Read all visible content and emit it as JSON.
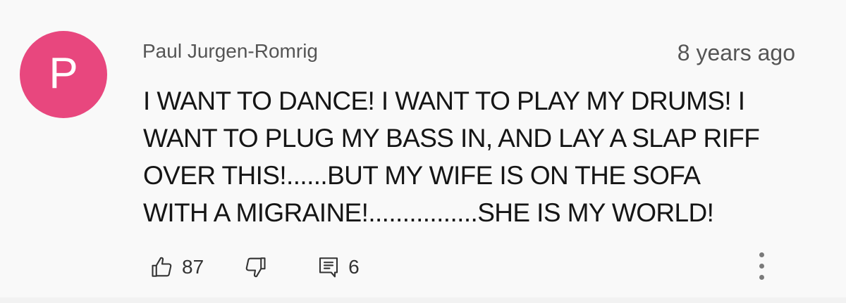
{
  "comment": {
    "avatar_letter": "P",
    "avatar_color": "#e8477e",
    "author": "Paul Jurgen-Romrig",
    "timestamp": "8 years ago",
    "text_lines": [
      "I WANT TO DANCE! I WANT TO PLAY MY DRUMS! I",
      "WANT TO PLUG MY BASS IN, AND LAY A SLAP RIFF",
      "OVER THIS!......BUT MY WIFE IS ON THE SOFA",
      "WITH A MIGRAINE!................SHE IS MY WORLD!"
    ],
    "actions": {
      "like_icon": "thumbs-up-icon",
      "like_count": "87",
      "dislike_icon": "thumbs-down-icon",
      "reply_icon": "reply-comment-icon",
      "reply_count": "6",
      "more_icon": "more-vertical-icon"
    }
  }
}
